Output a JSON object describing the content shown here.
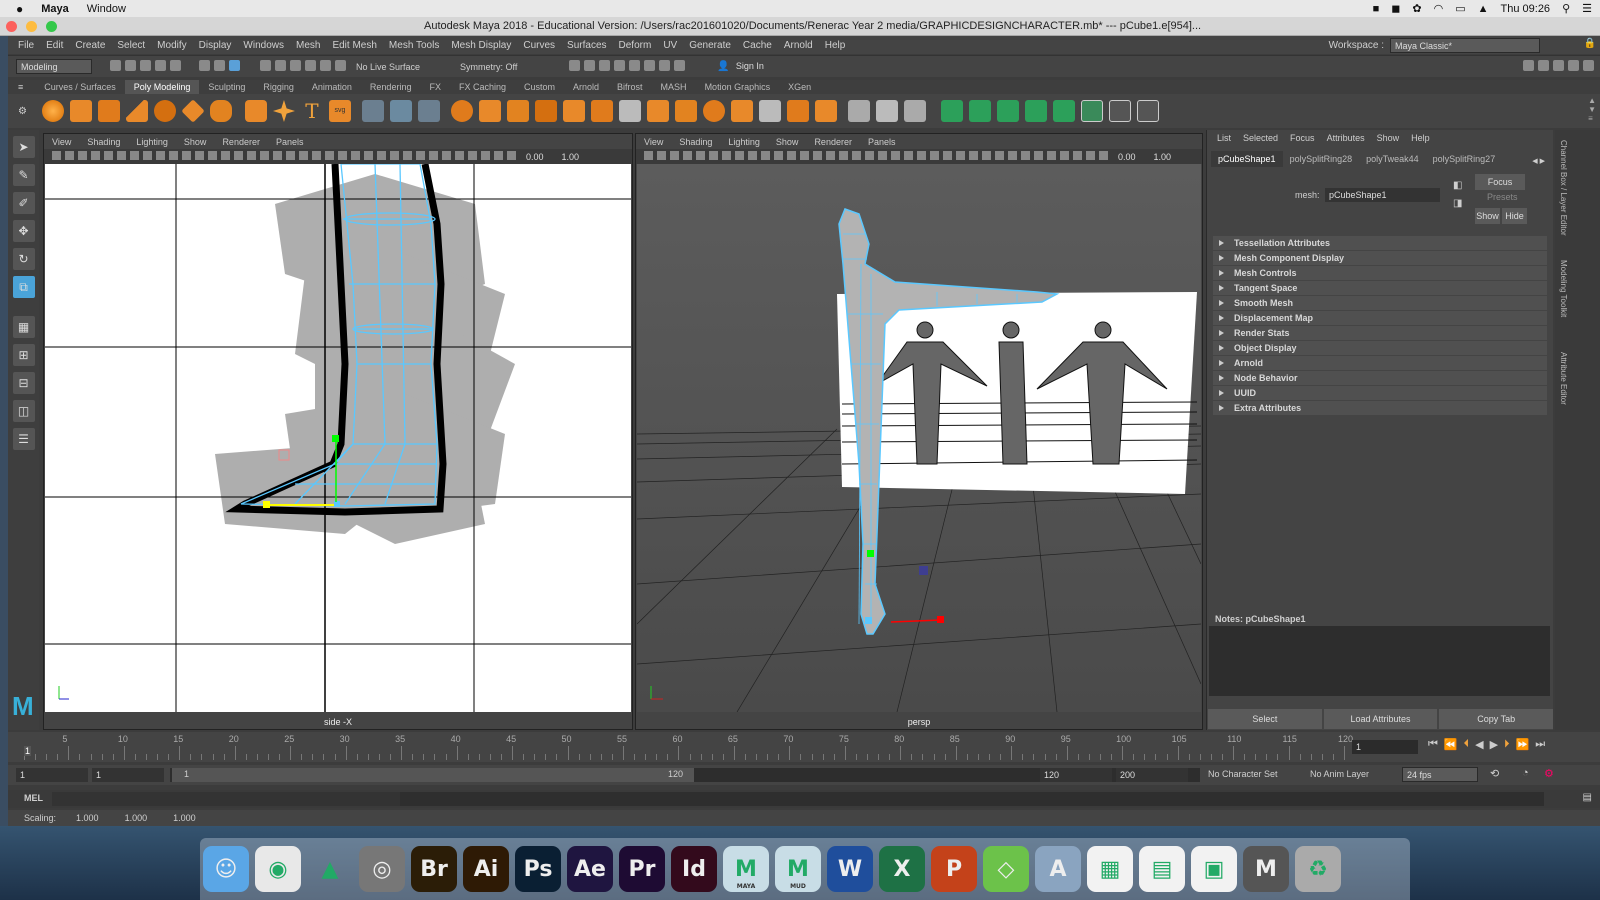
{
  "macbar": {
    "app": "Maya",
    "menu": "Window",
    "clock": "Thu 09:26"
  },
  "window": {
    "title": "Autodesk Maya 2018 - Educational Version: /Users/rac201601020/Documents/Renerac Year 2 media/GRAPHICDESIGNCHARACTER.mb*  ---  pCube1.e[954]..."
  },
  "menus": [
    "File",
    "Edit",
    "Create",
    "Select",
    "Modify",
    "Display",
    "Windows",
    "Mesh",
    "Edit Mesh",
    "Mesh Tools",
    "Mesh Display",
    "Curves",
    "Surfaces",
    "Deform",
    "UV",
    "Generate",
    "Cache",
    "Arnold",
    "Help"
  ],
  "workspace": {
    "label": "Workspace :",
    "value": "Maya Classic*"
  },
  "status": {
    "mode": "Modeling",
    "live": "No Live Surface",
    "symmetry": "Symmetry: Off",
    "signin": "Sign In"
  },
  "shelf_tabs": [
    "Curves / Surfaces",
    "Poly Modeling",
    "Sculpting",
    "Rigging",
    "Animation",
    "Rendering",
    "FX",
    "FX Caching",
    "Custom",
    "Arnold",
    "Bifrost",
    "MASH",
    "Motion Graphics",
    "XGen"
  ],
  "shelf_active": "Poly Modeling",
  "viewport_menu": [
    "View",
    "Shading",
    "Lighting",
    "Show",
    "Renderer",
    "Panels"
  ],
  "vp_values": {
    "a": "0.00",
    "b": "1.00"
  },
  "viewport_left": {
    "label": "side -X"
  },
  "viewport_right": {
    "label": "persp"
  },
  "panel": {
    "menu": [
      "List",
      "Selected",
      "Focus",
      "Attributes",
      "Show",
      "Help"
    ],
    "tabs": [
      "pCubeShape1",
      "polySplitRing28",
      "polyTweak44",
      "polySplitRing27"
    ],
    "mesh_label": "mesh:",
    "mesh_value": "pCubeShape1",
    "focus": "Focus",
    "presets": "Presets",
    "show": "Show",
    "hide": "Hide",
    "sections": [
      "Tessellation Attributes",
      "Mesh Component Display",
      "Mesh Controls",
      "Tangent Space",
      "Smooth Mesh",
      "Displacement Map",
      "Render Stats",
      "Object Display",
      "Arnold",
      "Node Behavior",
      "UUID",
      "Extra Attributes"
    ],
    "notes": "Notes:  pCubeShape1",
    "buttons": [
      "Select",
      "Load Attributes",
      "Copy Tab"
    ]
  },
  "side_tabs": [
    "Channel Box / Layer Editor",
    "Modeling Toolkit",
    "Attribute Editor"
  ],
  "timeline": {
    "ticks": [
      "5",
      "10",
      "15",
      "20",
      "25",
      "30",
      "35",
      "40",
      "45",
      "50",
      "55",
      "60",
      "65",
      "70",
      "75",
      "80",
      "85",
      "90",
      "95",
      "100",
      "105",
      "110",
      "115",
      "120"
    ],
    "current": "1",
    "frame_field": "1"
  },
  "range": {
    "start": "1",
    "start2": "1",
    "slider_start": "1",
    "slider_end": "120",
    "end": "120",
    "end2": "200",
    "charset": "No Character Set",
    "animlayer": "No Anim Layer",
    "fps": "24 fps"
  },
  "cmd": {
    "label": "MEL"
  },
  "help": {
    "label": "Scaling:",
    "x": "1.000",
    "y": "1.000",
    "z": "1.000"
  },
  "dock": [
    {
      "name": "finder",
      "label": "",
      "color": "#5aa6e6",
      "text": "☺"
    },
    {
      "name": "chrome",
      "label": "",
      "color": "#e8e8e8",
      "text": "◉"
    },
    {
      "name": "vlc",
      "label": "",
      "color": "transparent",
      "text": "▲"
    },
    {
      "name": "screenshot",
      "label": "",
      "color": "#777",
      "text": "◎"
    },
    {
      "name": "bridge",
      "label": "",
      "color": "#2b1d07",
      "text": "Br"
    },
    {
      "name": "illustrator",
      "label": "",
      "color": "#2e1a05",
      "text": "Ai"
    },
    {
      "name": "photoshop",
      "label": "",
      "color": "#0a1f33",
      "text": "Ps"
    },
    {
      "name": "after-effects",
      "label": "",
      "color": "#1f1540",
      "text": "Ae"
    },
    {
      "name": "premiere",
      "label": "",
      "color": "#1e0b33",
      "text": "Pr"
    },
    {
      "name": "indesign",
      "label": "",
      "color": "#330a1c",
      "text": "Id"
    },
    {
      "name": "maya",
      "label": "MAYA",
      "color": "#c8dde6",
      "text": "M"
    },
    {
      "name": "mudbox",
      "label": "MUD",
      "color": "#c8dde6",
      "text": "M"
    },
    {
      "name": "word",
      "label": "",
      "color": "#1f4e9c",
      "text": "W"
    },
    {
      "name": "excel",
      "label": "",
      "color": "#1e7145",
      "text": "X"
    },
    {
      "name": "powerpoint",
      "label": "",
      "color": "#c4421a",
      "text": "P"
    },
    {
      "name": "maps",
      "label": "",
      "color": "#6cc24a",
      "text": "◇"
    },
    {
      "name": "applications",
      "label": "",
      "color": "#8aa4c0",
      "text": "A"
    },
    {
      "name": "keynote-doc",
      "label": "",
      "color": "#f2f2f2",
      "text": "▦"
    },
    {
      "name": "document",
      "label": "",
      "color": "#f2f2f2",
      "text": "▤"
    },
    {
      "name": "screen",
      "label": "",
      "color": "#f2f2f2",
      "text": "▣"
    },
    {
      "name": "maya-file",
      "label": "",
      "color": "#555",
      "text": "M"
    },
    {
      "name": "trash",
      "label": "",
      "color": "#aaa",
      "text": "♻"
    }
  ],
  "colors": {
    "accent": "#5ac8ff",
    "selected_vertex": "#ffff00",
    "green": "#00ff00",
    "red": "#ff0000"
  }
}
